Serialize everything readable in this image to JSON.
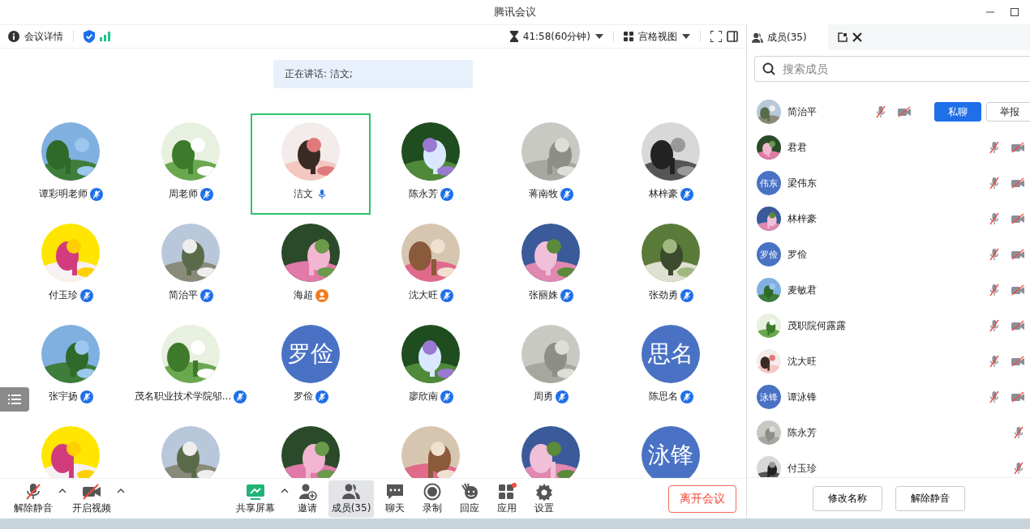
{
  "window": {
    "title": "腾讯会议"
  },
  "toolbar": {
    "meeting_info": "会议详情",
    "timer": "41:58(60分钟)",
    "view": "宫格视图"
  },
  "speaking_banner": "正在讲话: 洁文;",
  "participants": [
    {
      "name": "谭彩明老师",
      "kind": "picture",
      "audio_connected": true,
      "muted": true,
      "selected": false
    },
    {
      "name": "周老师",
      "kind": "picture",
      "audio_connected": true,
      "muted": true,
      "selected": false
    },
    {
      "name": "洁文",
      "kind": "picture",
      "audio_connected": true,
      "muted": false,
      "selected": true
    },
    {
      "name": "陈永芳",
      "kind": "picture",
      "audio_connected": true,
      "muted": true,
      "selected": false
    },
    {
      "name": "蒋南牧",
      "kind": "picture",
      "audio_connected": true,
      "muted": true,
      "selected": false
    },
    {
      "name": "林梓豪",
      "kind": "picture",
      "audio_connected": true,
      "muted": true,
      "selected": false
    },
    {
      "name": "付玉珍",
      "kind": "picture",
      "audio_connected": true,
      "muted": true,
      "selected": false
    },
    {
      "name": "简治平",
      "kind": "picture",
      "audio_connected": true,
      "muted": true,
      "selected": false
    },
    {
      "name": "海超",
      "kind": "picture",
      "audio_connected": false,
      "selected": false
    },
    {
      "name": "沈大旺",
      "kind": "picture",
      "audio_connected": true,
      "muted": true,
      "selected": false
    },
    {
      "name": "张丽姝",
      "kind": "picture",
      "audio_connected": true,
      "muted": true,
      "selected": false
    },
    {
      "name": "张劲勇",
      "kind": "picture",
      "audio_connected": true,
      "muted": true,
      "selected": false
    },
    {
      "name": "张宇扬",
      "kind": "picture",
      "audio_connected": true,
      "muted": true,
      "selected": false
    },
    {
      "name": "茂名职业技术学院邬...",
      "kind": "picture",
      "audio_connected": true,
      "muted": true,
      "selected": false
    },
    {
      "name": "罗俭",
      "kind": "text",
      "avatar_text": "罗俭",
      "audio_connected": true,
      "muted": true,
      "selected": false
    },
    {
      "name": "廖欣南",
      "kind": "picture",
      "audio_connected": true,
      "muted": true,
      "selected": false
    },
    {
      "name": "周勇",
      "kind": "picture",
      "audio_connected": true,
      "muted": true,
      "selected": false
    },
    {
      "name": "陈思名",
      "kind": "text",
      "avatar_text": "思名",
      "audio_connected": true,
      "muted": true,
      "selected": false
    },
    {
      "kind": "picture",
      "selected": false
    },
    {
      "kind": "picture",
      "selected": false
    },
    {
      "kind": "picture",
      "selected": false
    },
    {
      "kind": "picture",
      "selected": false
    },
    {
      "kind": "picture",
      "selected": false
    },
    {
      "kind": "text",
      "avatar_text": "泳锋",
      "selected": false
    }
  ],
  "bottom_toolbar": [
    {
      "label": "解除静音",
      "kind": "mic",
      "caret": true,
      "selected": false
    },
    {
      "label": "开启视频",
      "kind": "camera",
      "caret": true,
      "selected": false
    },
    {
      "label": "共享屏幕",
      "kind": "share",
      "caret": true,
      "selected": false
    },
    {
      "label": "邀请",
      "kind": "invite",
      "caret": false,
      "selected": false
    },
    {
      "label": "成员(35)",
      "kind": "members",
      "caret": false,
      "selected": true
    },
    {
      "label": "聊天",
      "kind": "chat",
      "caret": false,
      "selected": false
    },
    {
      "label": "录制",
      "kind": "record",
      "caret": false,
      "selected": false
    },
    {
      "label": "回应",
      "kind": "react",
      "caret": false,
      "selected": false
    },
    {
      "label": "应用",
      "kind": "apps",
      "caret": false,
      "selected": false,
      "dot": true
    },
    {
      "label": "设置",
      "kind": "settings",
      "caret": false,
      "selected": false
    }
  ],
  "leave_button": "离开会议",
  "member_panel": {
    "tab": "成员(35)",
    "search": {
      "placeholder": "搜索成员"
    },
    "members": [
      {
        "name": "简治平",
        "kind": "picture",
        "mic_muted": true,
        "video_muted": true,
        "actions": [
          "私聊",
          "举报"
        ]
      },
      {
        "name": "君君",
        "kind": "picture",
        "mic_muted": true,
        "video_muted": true
      },
      {
        "name": "梁伟东",
        "kind": "text",
        "avatar_text": "伟东",
        "mic_muted": true,
        "video_muted": true
      },
      {
        "name": "林梓豪",
        "kind": "picture",
        "mic_muted": true,
        "video_muted": true
      },
      {
        "name": "罗俭",
        "kind": "text",
        "avatar_text": "罗俭",
        "mic_muted": true,
        "video_muted": true
      },
      {
        "name": "麦敏君",
        "kind": "picture",
        "mic_muted": true,
        "video_muted": true
      },
      {
        "name": "茂职院何露露",
        "kind": "picture",
        "mic_muted": true,
        "video_muted": true
      },
      {
        "name": "沈大旺",
        "kind": "picture",
        "mic_muted": true,
        "video_muted": true
      },
      {
        "name": "谭泳锋",
        "kind": "text",
        "avatar_text": "泳锋",
        "mic_muted": true,
        "video_muted": true
      },
      {
        "name": "陈永芳",
        "kind": "picture",
        "mic_muted": true,
        "video_muted": false
      },
      {
        "name": "付玉珍",
        "kind": "picture",
        "mic_muted": true,
        "video_muted": false
      }
    ],
    "footer_buttons": [
      "修改名称",
      "解除静音"
    ]
  }
}
